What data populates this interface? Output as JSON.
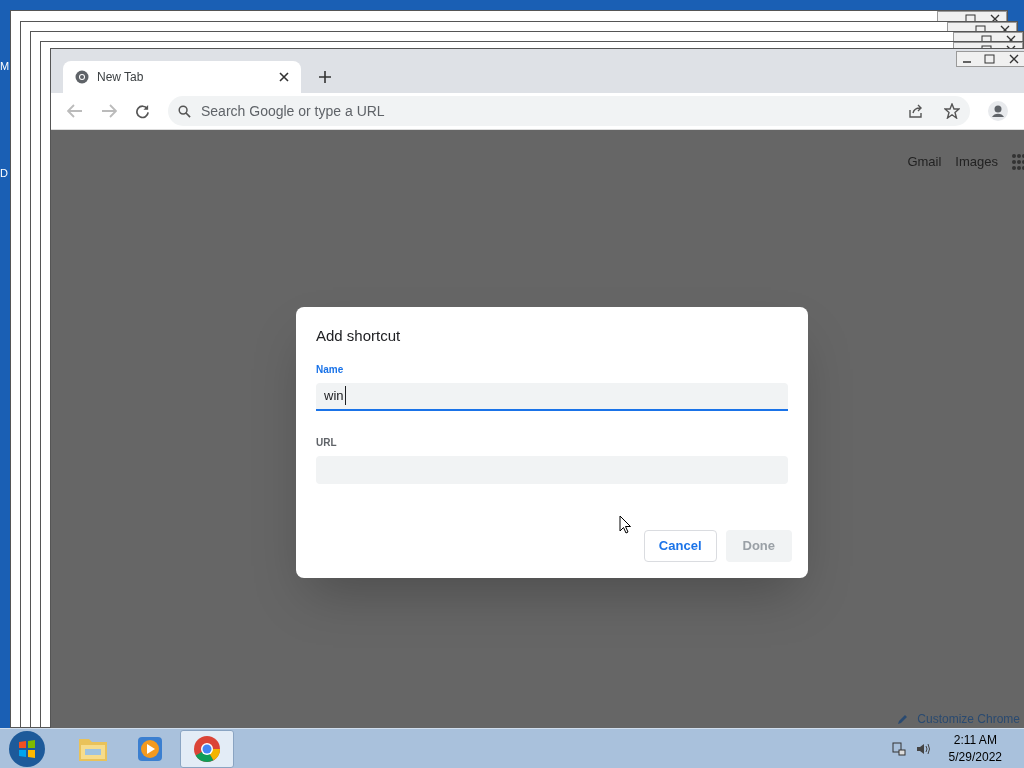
{
  "desktop": {
    "icon_labels": [
      "M",
      "D"
    ]
  },
  "browser": {
    "tabs": [
      {
        "title": "New Tab",
        "selected": true
      }
    ],
    "omnibox": {
      "placeholder": "Search Google or type a URL"
    },
    "header_links": [
      "Gmail",
      "Images"
    ],
    "customize_label": "Customize Chrome"
  },
  "dialog": {
    "title": "Add shortcut",
    "fields": [
      {
        "label": "Name",
        "value": "win",
        "focused": true
      },
      {
        "label": "URL",
        "focused": false
      }
    ],
    "buttons": [
      {
        "label": "Cancel",
        "disabled": false
      },
      {
        "label": "Done",
        "disabled": true
      }
    ]
  },
  "taskbar": {
    "apps": [
      {
        "kind": "folder",
        "selected": false
      },
      {
        "kind": "media",
        "selected": false
      },
      {
        "kind": "browser",
        "selected": true
      }
    ],
    "clock": {
      "time": "2:11 AM",
      "date": "5/29/2022"
    }
  }
}
